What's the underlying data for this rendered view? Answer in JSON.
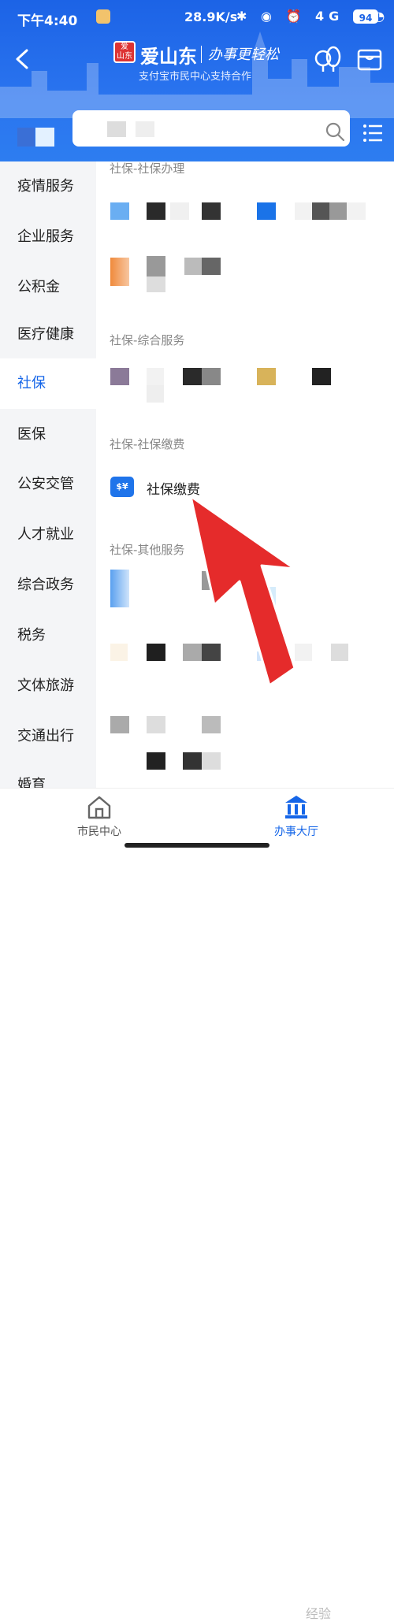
{
  "status_bar": {
    "time": "下午4:40",
    "network_speed": "28.9K/s",
    "network_type": "4G",
    "battery": "94"
  },
  "header": {
    "brand": "爱山东",
    "slogan": "办事更轻松",
    "subtitle": "支付宝市民中心支持合作",
    "seal_text": "爱山东",
    "search_placeholder": ""
  },
  "sidebar": {
    "items": [
      {
        "label": "疫情服务"
      },
      {
        "label": "企业服务"
      },
      {
        "label": "公积金"
      },
      {
        "label": "医疗健康"
      },
      {
        "label": "社保",
        "active": true
      },
      {
        "label": "医保"
      },
      {
        "label": "公安交管"
      },
      {
        "label": "人才就业"
      },
      {
        "label": "综合政务"
      },
      {
        "label": "税务"
      },
      {
        "label": "文体旅游"
      },
      {
        "label": "交通出行"
      },
      {
        "label": "婚育"
      }
    ]
  },
  "main": {
    "sections": [
      {
        "title": "社保-社保办理"
      },
      {
        "title": "社保-综合服务"
      },
      {
        "title": "社保-社保缴费"
      },
      {
        "title": "社保-其他服务"
      }
    ],
    "highlighted_service": {
      "label": "社保缴费",
      "icon": "social-security-payment-icon"
    }
  },
  "tabbar": {
    "home_label": "市民中心",
    "hall_label": "办事大厅"
  },
  "watermark": "经验",
  "colors": {
    "header_blue": "#1c63e6",
    "active_blue": "#1666e8",
    "arrow_red": "#e52b2b"
  }
}
